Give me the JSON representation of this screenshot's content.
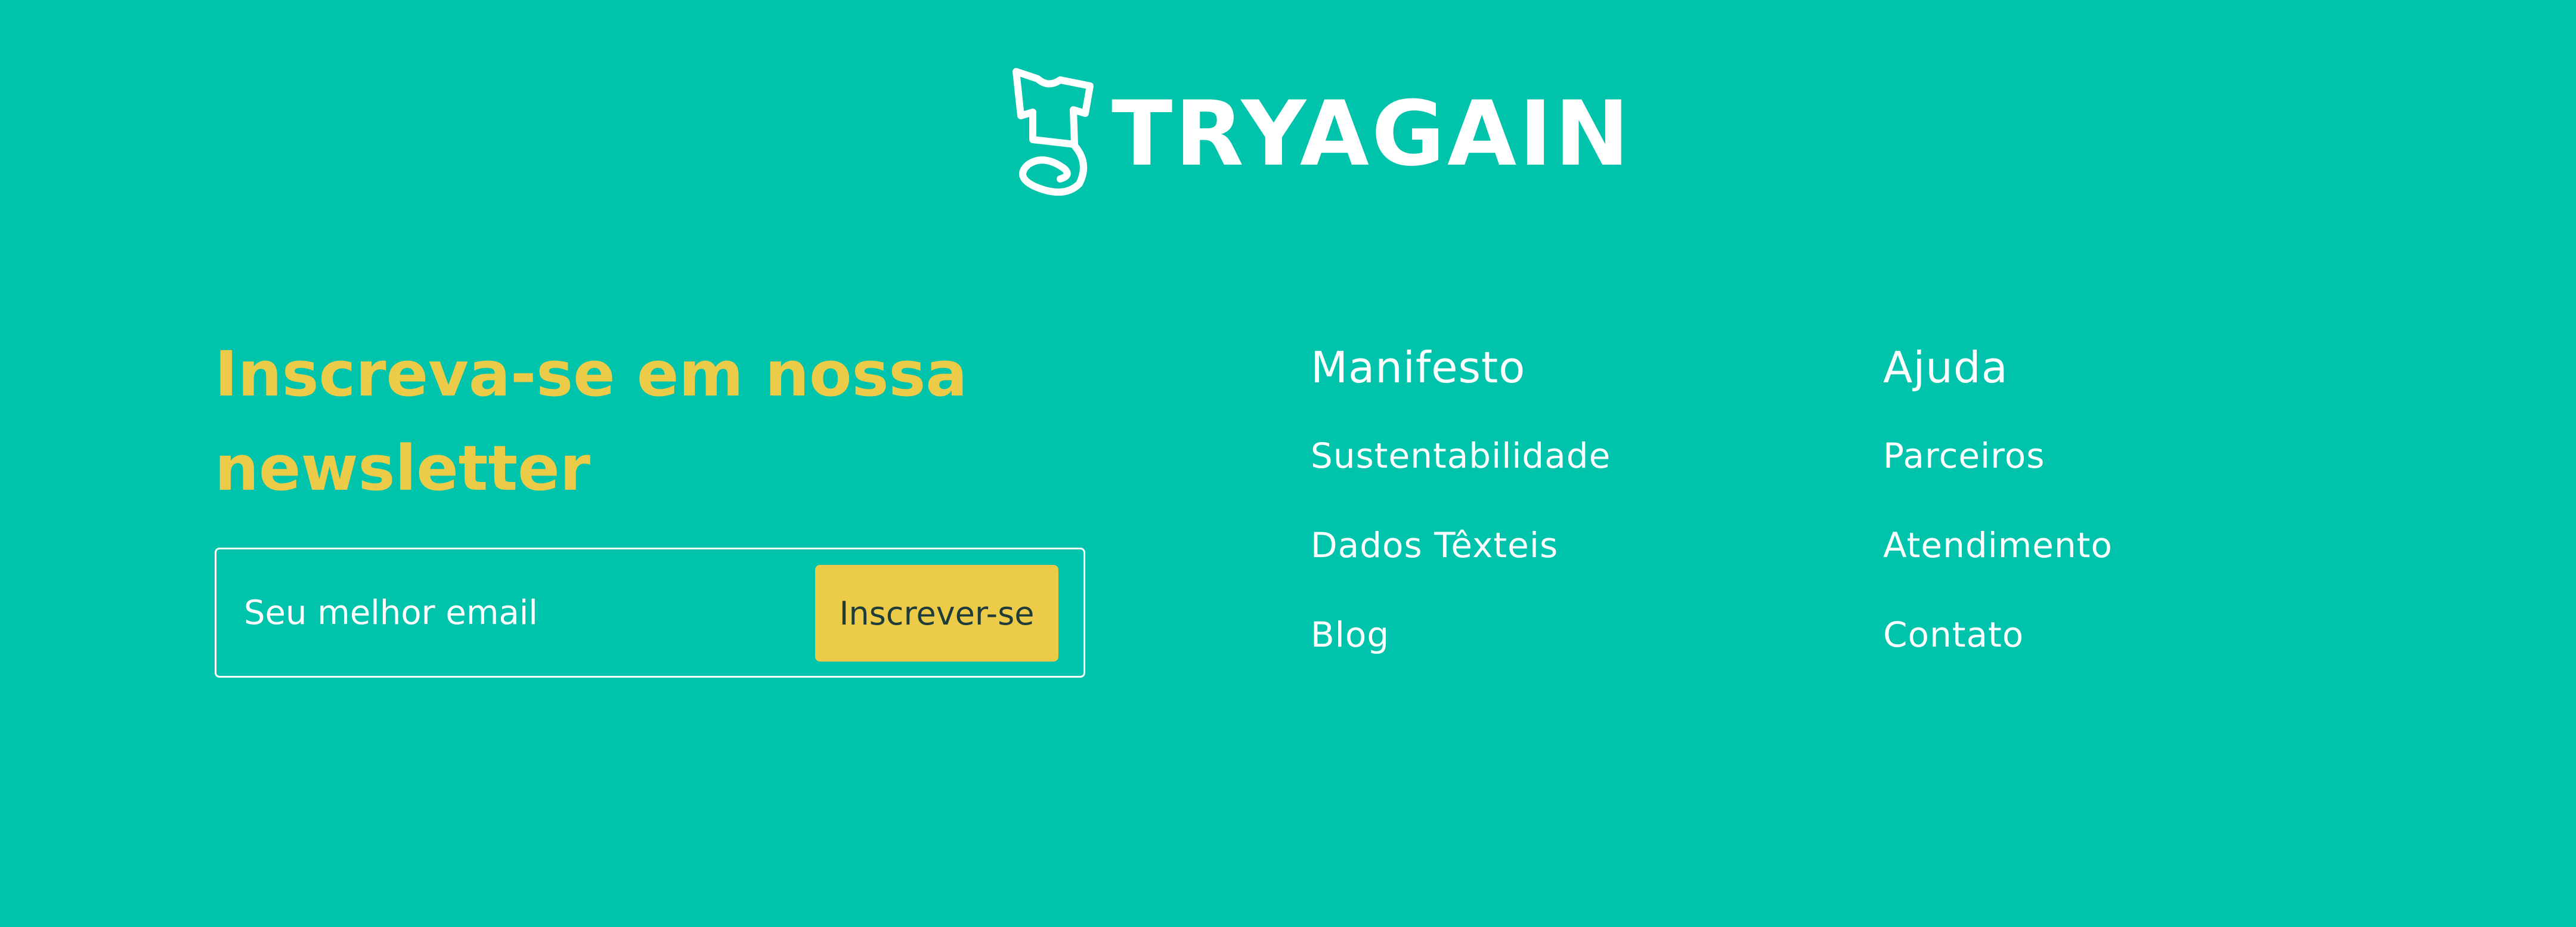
{
  "colors": {
    "background": "#00C3AC",
    "accent": "#ECCB48",
    "text": "#FFFFFF"
  },
  "brand": {
    "name": "TRYAGAIN",
    "icon": "tshirt-spiral-logo-icon"
  },
  "newsletter": {
    "title": "Inscreva-se em nossa newsletter",
    "email_placeholder": "Seu melhor email",
    "button_label": "Inscrever-se"
  },
  "columns": [
    {
      "heading": "Manifesto",
      "links": [
        "Sustentabilidade",
        "Dados Têxteis",
        "Blog"
      ]
    },
    {
      "heading": "Ajuda",
      "links": [
        "Parceiros",
        "Atendimento",
        "Contato"
      ]
    }
  ]
}
